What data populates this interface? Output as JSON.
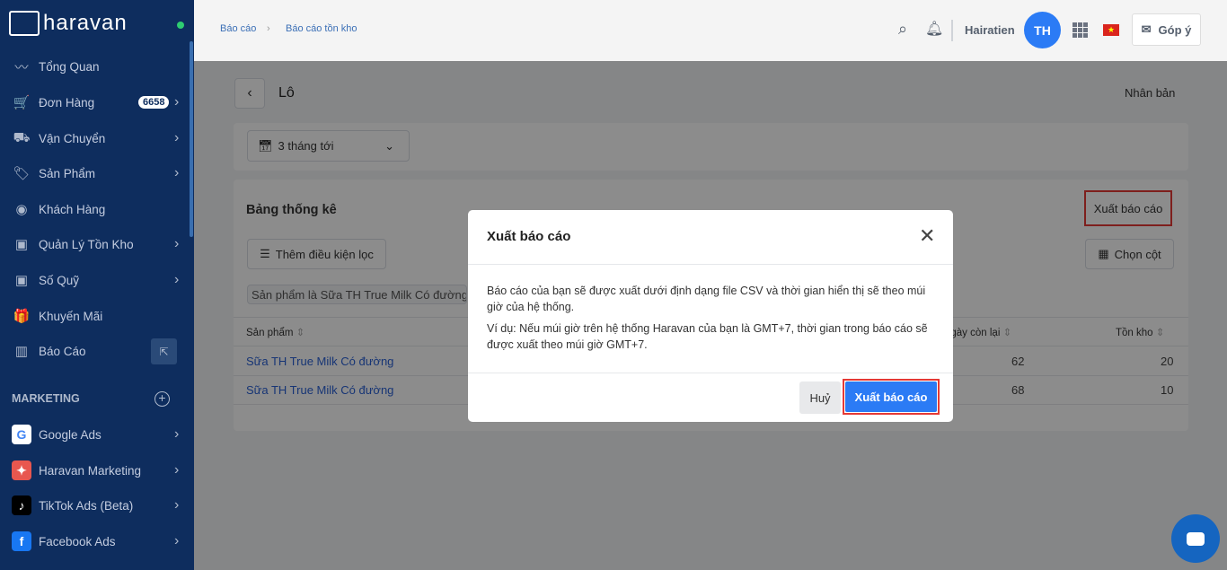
{
  "brand": {
    "name": "haravan"
  },
  "sidebar": {
    "items": [
      {
        "label": "Tổng Quan",
        "icon": "trend-icon"
      },
      {
        "label": "Đơn Hàng",
        "icon": "cart-icon",
        "badge": "6658"
      },
      {
        "label": "Vận Chuyển",
        "icon": "truck-icon"
      },
      {
        "label": "Sản Phẩm",
        "icon": "tag-icon"
      },
      {
        "label": "Khách Hàng",
        "icon": "user-circle-icon"
      },
      {
        "label": "Quản Lý Tồn Kho",
        "icon": "inventory-icon"
      },
      {
        "label": "Số Quỹ",
        "icon": "cashbook-icon"
      },
      {
        "label": "Khuyến Mãi",
        "icon": "gift-icon"
      },
      {
        "label": "Báo Cáo",
        "icon": "chart-icon"
      }
    ],
    "marketing_title": "MARKETING",
    "marketing": [
      {
        "label": "Google Ads"
      },
      {
        "label": "Haravan Marketing"
      },
      {
        "label": "TikTok Ads (Beta)"
      },
      {
        "label": "Facebook Ads"
      }
    ]
  },
  "header": {
    "breadcrumb": [
      "Báo cáo",
      "Báo cáo tồn kho"
    ],
    "user": "Hairatien",
    "avatar": "TH",
    "feedback": "Góp ý"
  },
  "page": {
    "title": "Lô",
    "duplicate": "Nhân bản",
    "date_range": "3 tháng tới",
    "stats_title": "Bảng thống kê",
    "export": "Xuất báo cáo",
    "add_filter": "Thêm điều kiện lọc",
    "choose_columns": "Chọn cột",
    "filter_tag": "Sản phẩm là Sữa TH True Milk Có đường",
    "columns": [
      "Sản phẩm",
      "ngày còn lại",
      "Tồn kho"
    ],
    "rows": [
      {
        "product": "Sữa TH True Milk Có đường",
        "days": "62",
        "stock": "20"
      },
      {
        "product": "Sữa TH True Milk Có đường",
        "days": "68",
        "stock": "10"
      }
    ]
  },
  "modal": {
    "title": "Xuất báo cáo",
    "p1": "Báo cáo của bạn sẽ được xuất dưới định dạng file CSV và thời gian hiển thị sẽ theo múi giờ của hệ thống.",
    "p2": "Ví dụ: Nếu múi giờ trên hệ thống Haravan của bạn là GMT+7, thời gian trong báo cáo sẽ được xuất theo múi giờ GMT+7.",
    "cancel": "Huỷ",
    "confirm": "Xuất báo cáo"
  }
}
